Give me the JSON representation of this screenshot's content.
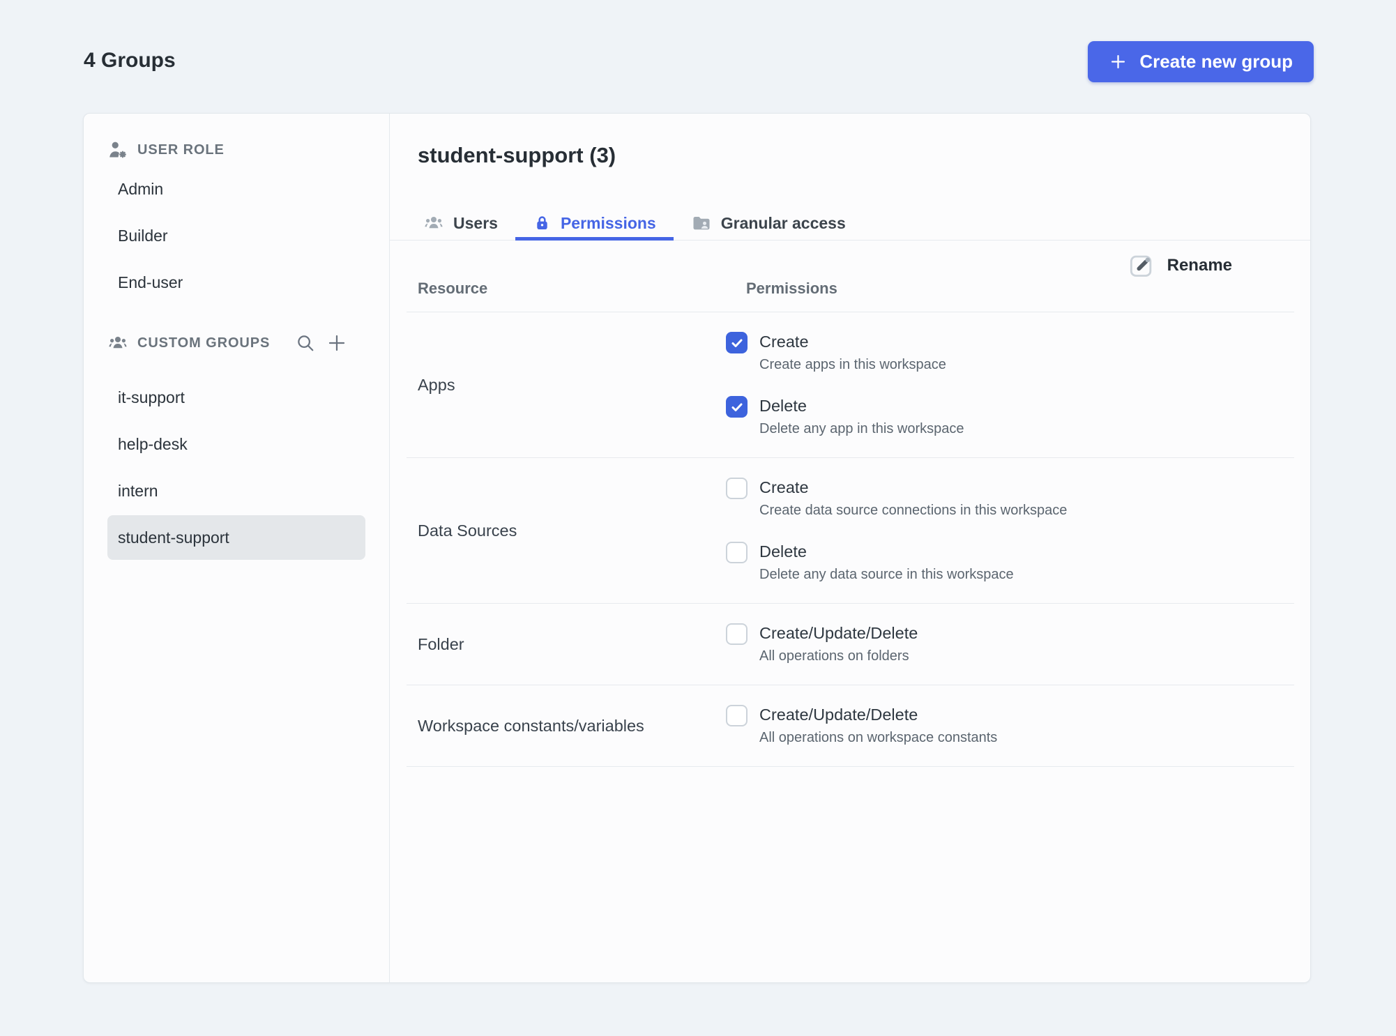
{
  "page": {
    "title": "4 Groups",
    "create_button_label": "Create new group"
  },
  "colors": {
    "page_background": "#eff3f7",
    "accent_blue": "#4565e5",
    "button_blue": "#4a67e8",
    "checkbox_checked_blue": "#3d63dd",
    "selected_item_background": "#e4e7ea"
  },
  "icons": {
    "user_role_section": "user-gear-icon",
    "custom_groups_section": "people-icon",
    "groups_search": "search-icon",
    "groups_add": "plus-icon",
    "tab_users": "people-icon",
    "tab_permissions": "lock-icon",
    "tab_granular": "folder-user-icon",
    "rename": "edit-pencil-icon",
    "create_button": "plus-icon"
  },
  "sidebar": {
    "sections": [
      {
        "label": "USER ROLE",
        "items": [
          {
            "label": "Admin",
            "selected": false
          },
          {
            "label": "Builder",
            "selected": false
          },
          {
            "label": "End-user",
            "selected": false
          }
        ]
      },
      {
        "label": "CUSTOM GROUPS",
        "items": [
          {
            "label": "it-support",
            "selected": false
          },
          {
            "label": "help-desk",
            "selected": false
          },
          {
            "label": "intern",
            "selected": false
          },
          {
            "label": "student-support",
            "selected": true
          }
        ]
      }
    ]
  },
  "panel": {
    "title": "student-support (3)",
    "rename_label": "Rename",
    "tabs": [
      {
        "label": "Users",
        "active": false
      },
      {
        "label": "Permissions",
        "active": true
      },
      {
        "label": "Granular access",
        "active": false
      }
    ],
    "table": {
      "headers": {
        "resource": "Resource",
        "permissions": "Permissions"
      },
      "rows": [
        {
          "resource": "Apps",
          "permissions": [
            {
              "label": "Create",
              "description": "Create apps in this workspace",
              "checked": true
            },
            {
              "label": "Delete",
              "description": "Delete any app in this workspace",
              "checked": true
            }
          ]
        },
        {
          "resource": "Data Sources",
          "permissions": [
            {
              "label": "Create",
              "description": "Create data source connections in this workspace",
              "checked": false
            },
            {
              "label": "Delete",
              "description": "Delete any data source in this workspace",
              "checked": false
            }
          ]
        },
        {
          "resource": "Folder",
          "permissions": [
            {
              "label": "Create/Update/Delete",
              "description": "All operations on folders",
              "checked": false
            }
          ]
        },
        {
          "resource": "Workspace constants/variables",
          "permissions": [
            {
              "label": "Create/Update/Delete",
              "description": "All operations on workspace constants",
              "checked": false
            }
          ]
        }
      ]
    }
  }
}
